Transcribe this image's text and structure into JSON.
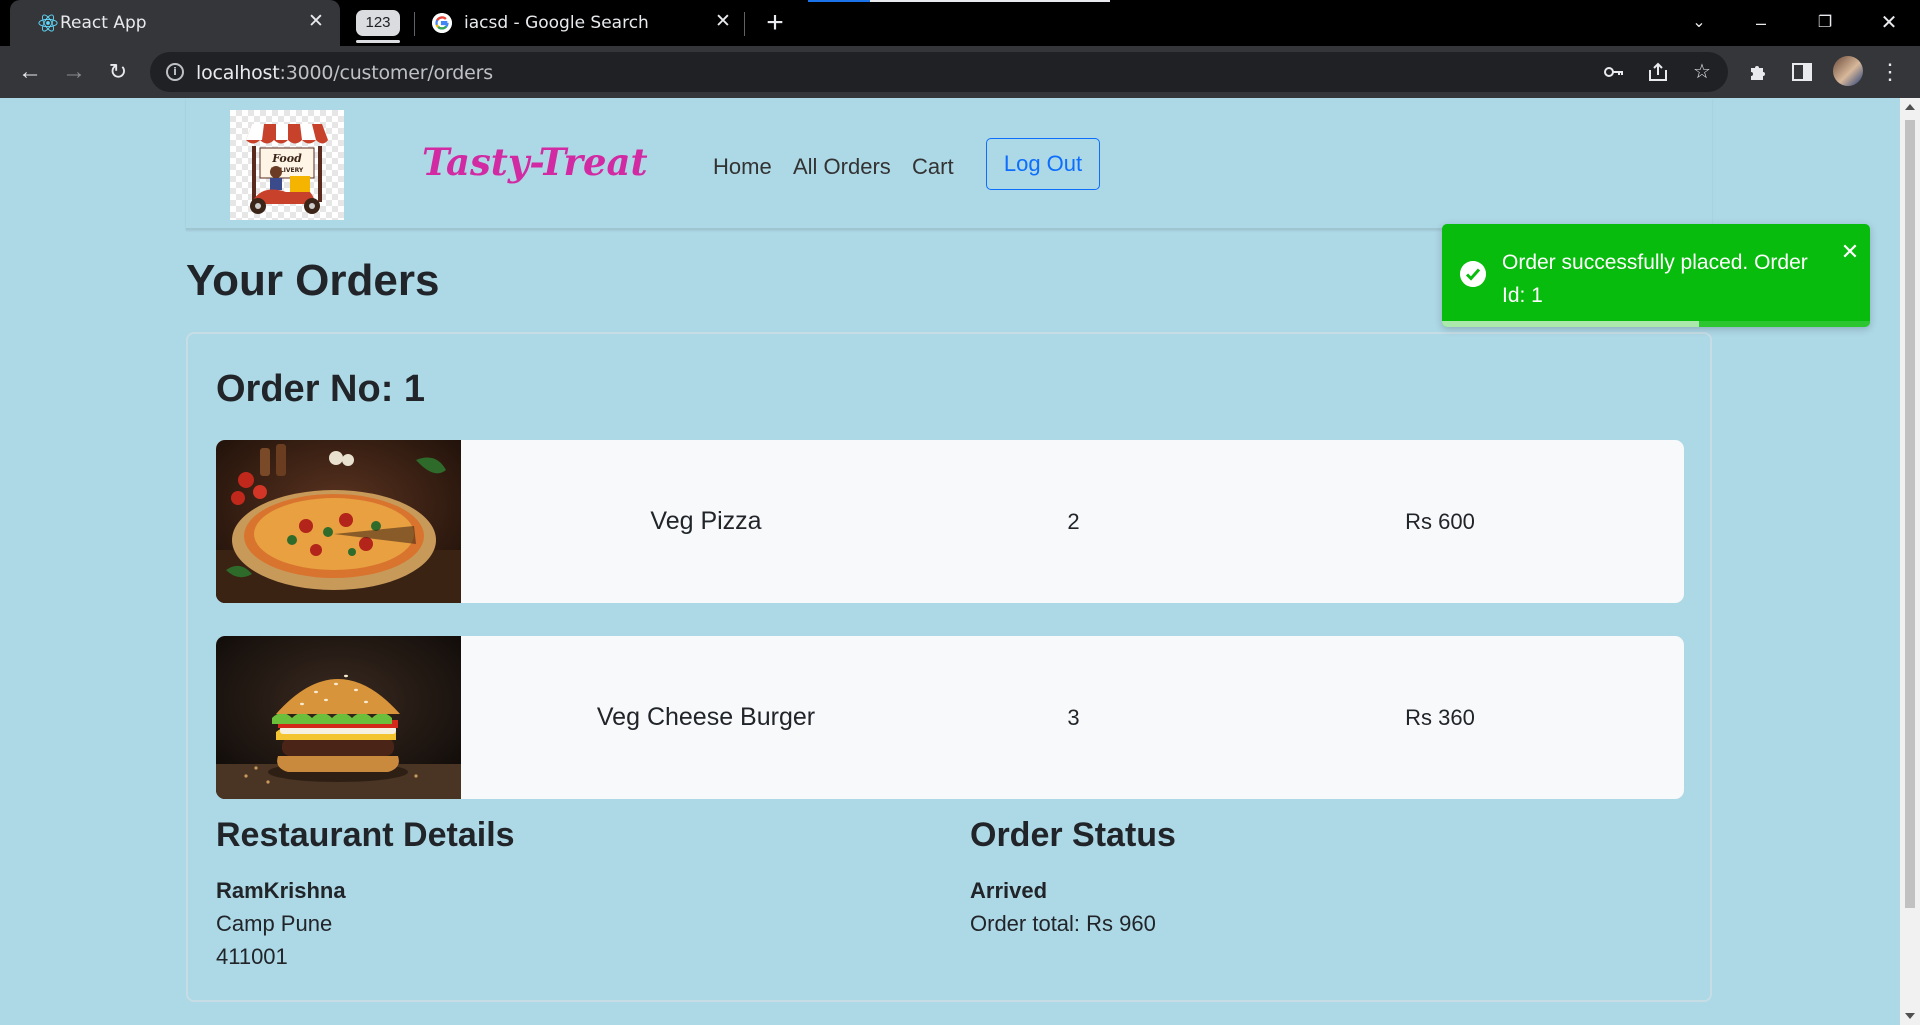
{
  "browser": {
    "tabs": [
      {
        "title": "React App",
        "active": true
      },
      {
        "title": "iacsd - Google Search",
        "active": false
      }
    ],
    "tab_group_label": "123",
    "url_host": "localhost",
    "url_path": ":3000/customer/orders"
  },
  "navbar": {
    "brand": "Tasty-Treat",
    "links": [
      "Home",
      "All Orders",
      "Cart"
    ],
    "logout_label": "Log Out",
    "logo_lines": [
      "Food",
      "DELIVERY"
    ]
  },
  "page": {
    "title": "Your Orders"
  },
  "order": {
    "title": "Order No: 1",
    "items": [
      {
        "name": "Veg Pizza",
        "qty": "2",
        "price": "Rs 600",
        "image": "pizza"
      },
      {
        "name": "Veg Cheese Burger",
        "qty": "3",
        "price": "Rs 360",
        "image": "burger"
      }
    ],
    "restaurant": {
      "heading": "Restaurant Details",
      "name": "RamKrishna",
      "address": "Camp Pune",
      "pincode": "411001"
    },
    "status": {
      "heading": "Order Status",
      "value": "Arrived",
      "total": "Order total: Rs 960"
    }
  },
  "toast": {
    "message": "Order successfully placed. Order Id: 1",
    "progress": 0.6,
    "color": "#07bc0c"
  },
  "colors": {
    "page_bg": "#add8e6",
    "brand": "#d12aa3",
    "link_primary": "#0d6efd"
  }
}
